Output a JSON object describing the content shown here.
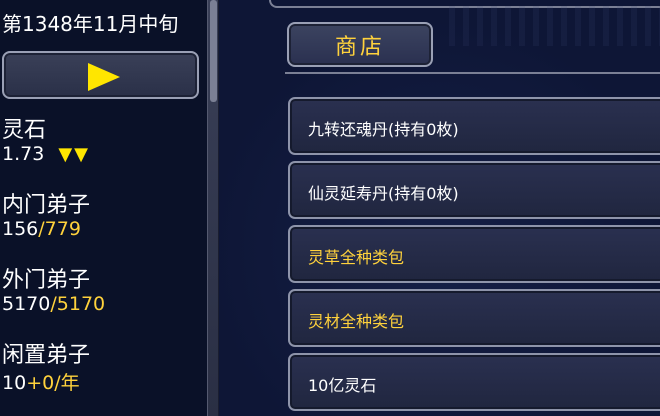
{
  "status": {
    "date": "第1348年11月中旬",
    "lingshi": {
      "label": "灵石",
      "value": "1.73",
      "arrows": "▼▼"
    },
    "inner_disciples": {
      "label": "内门弟子",
      "current": "156",
      "max": "/779"
    },
    "outer_disciples": {
      "label": "外门弟子",
      "current": "5170",
      "max": "/5170"
    },
    "idle_disciples": {
      "label": "闲置弟子",
      "current": "10",
      "rate": "+0/年"
    }
  },
  "shop": {
    "title": "商店",
    "items": [
      {
        "label": "九转还魂丹(持有0枚)"
      },
      {
        "label": "仙灵延寿丹(持有0枚)"
      },
      {
        "label": "灵草全种类包"
      },
      {
        "label": "灵材全种类包"
      },
      {
        "label": "10亿灵石"
      }
    ]
  },
  "colors": {
    "accent_yellow": "#ffd23c",
    "play_yellow": "#ffe600",
    "panel_border": "#9aa0b5"
  }
}
